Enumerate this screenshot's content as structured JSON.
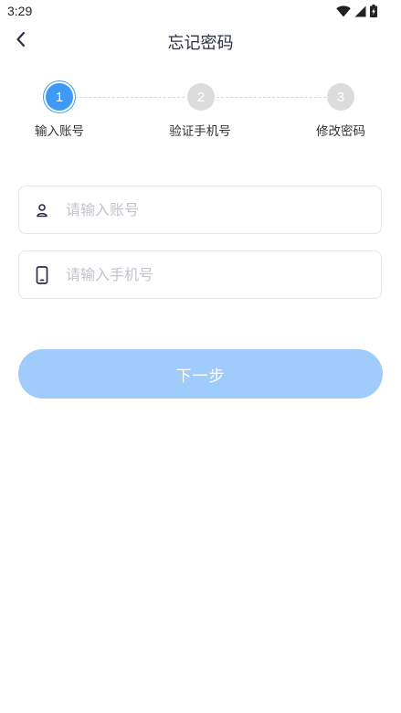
{
  "status_bar": {
    "time": "3:29",
    "icons": [
      "wifi-icon",
      "signal-icon",
      "battery-charging-icon"
    ]
  },
  "header": {
    "title": "忘记密码",
    "back_icon": "chevron-left-icon"
  },
  "stepper": {
    "active_step": 1,
    "steps": [
      {
        "number": "1",
        "label": "输入账号"
      },
      {
        "number": "2",
        "label": "验证手机号"
      },
      {
        "number": "3",
        "label": "修改密码"
      }
    ]
  },
  "form": {
    "account": {
      "placeholder": "请输入账号",
      "value": "",
      "icon": "user-icon"
    },
    "phone": {
      "placeholder": "请输入手机号",
      "value": "",
      "icon": "phone-icon"
    }
  },
  "next_button": {
    "label": "下一步"
  },
  "colors": {
    "primary": "#3d9bf7",
    "button_disabled": "#a0ccfb",
    "step_inactive": "#dcdcdc",
    "title": "#2a2f45",
    "placeholder": "#c2c4cc"
  }
}
